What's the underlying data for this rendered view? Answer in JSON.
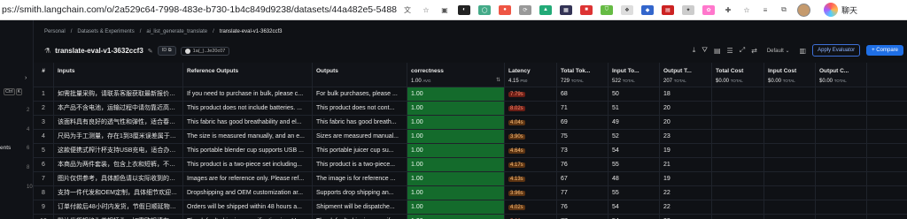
{
  "browser": {
    "url": "ps://smith.langchain.com/o/2a529c64-7998-483e-b730-1b4c849d9238/datasets/44a482e5-5488-45a2-8a37-f...",
    "chat_label": "聊天"
  },
  "rail": {
    "shortcut": [
      "Ctrl",
      "K"
    ],
    "nums": [
      "2",
      "4",
      "6",
      "8",
      "10"
    ],
    "ents_label": "ents"
  },
  "breadcrumb": [
    "Personal",
    "Datasets & Experiments",
    "ai_list_generate_translate",
    "translate-eval-v1-3632ccf3"
  ],
  "header": {
    "title": "translate-eval-v1-3632ccf3",
    "id_pill": "ID",
    "commit_pill": "1a(_)..Je20c07"
  },
  "toolbar": {
    "default_select": "Default",
    "apply_evaluator": "Apply Evaluator",
    "compare": "+ Compare"
  },
  "columns": {
    "idx": "#",
    "inputs": "Inputs",
    "reference": "Reference Outputs",
    "outputs": "Outputs",
    "correctness": "correctness",
    "correctness_sub": "1.00",
    "correctness_sub_suffix": "AVG",
    "latency": "Latency",
    "latency_sub": "4.15",
    "latency_sub_suffix": "P50",
    "total_tokens": "Total Tok...",
    "total_tokens_sub": "729",
    "total_tokens_sub_suffix": "TOTAL",
    "input_tokens": "Input To...",
    "input_tokens_sub": "522",
    "input_tokens_sub_suffix": "TOTAL",
    "output_tokens": "Output T...",
    "output_tokens_sub": "207",
    "output_tokens_sub_suffix": "TOTAL",
    "total_cost": "Total Cost",
    "total_cost_sub": "$0.00",
    "total_cost_sub_suffix": "TOTAL",
    "input_cost": "Input Cost",
    "input_cost_sub": "$0.00",
    "input_cost_sub_suffix": "TOTAL",
    "output_cost": "Output C...",
    "output_cost_sub": "$0.00",
    "output_cost_sub_suffix": "TOTAL"
  },
  "rows": [
    {
      "n": "1",
      "inputs": "如需批量采购，请联系客服获取最新报价和...",
      "ref": "If you need to purchase in bulk, please c...",
      "out": "For bulk purchases, please ...",
      "corr": "1.00",
      "lat": "7.79s",
      "lat_level": "hi",
      "tt": "68",
      "it": "50",
      "ot": "18"
    },
    {
      "n": "2",
      "inputs": "本产品不含电池，运输过程中请勿靠近高温...",
      "ref": "This product does not include batteries. ...",
      "out": "This product does not cont...",
      "corr": "1.00",
      "lat": "8.02s",
      "lat_level": "hi",
      "tt": "71",
      "it": "51",
      "ot": "20"
    },
    {
      "n": "3",
      "inputs": "该面料具有良好的透气性和弹性，适合春夏...",
      "ref": "This fabric has good breathability and el...",
      "out": "This fabric has good breath...",
      "corr": "1.00",
      "lat": "4.04s",
      "lat_level": "mid",
      "tt": "69",
      "it": "49",
      "ot": "20"
    },
    {
      "n": "4",
      "inputs": "尺码为手工测量，存在1到3厘米误差属于正...",
      "ref": "The size is measured manually, and an e...",
      "out": "Sizes are measured manual...",
      "corr": "1.00",
      "lat": "3.90s",
      "lat_level": "mid",
      "tt": "75",
      "it": "52",
      "ot": "23"
    },
    {
      "n": "5",
      "inputs": "这款便携式榨汁杯支持USB充电，适合办公...",
      "ref": "This portable blender cup supports USB ...",
      "out": "This portable juicer cup su...",
      "corr": "1.00",
      "lat": "4.64s",
      "lat_level": "mid",
      "tt": "73",
      "it": "54",
      "ot": "19"
    },
    {
      "n": "6",
      "inputs": "本商品为两件套装，包含上衣和短裤，不单...",
      "ref": "This product is a two-piece set including...",
      "out": "This product is a two-piece...",
      "corr": "1.00",
      "lat": "4.17s",
      "lat_level": "mid",
      "tt": "76",
      "it": "55",
      "ot": "21"
    },
    {
      "n": "7",
      "inputs": "图片仅供参考，具体颜色请以实际收到的商...",
      "ref": "Images are for reference only. Please ref...",
      "out": "The image is for reference ...",
      "corr": "1.00",
      "lat": "4.13s",
      "lat_level": "mid",
      "tt": "67",
      "it": "48",
      "ot": "19"
    },
    {
      "n": "8",
      "inputs": "支持一件代发和OEM定制，具体细节欢迎来...",
      "ref": "Dropshipping and OEM customization ar...",
      "out": "Supports drop shipping an...",
      "corr": "1.00",
      "lat": "3.96s",
      "lat_level": "mid",
      "tt": "77",
      "it": "55",
      "ot": "22"
    },
    {
      "n": "9",
      "inputs": "订单付款后48小时内发货，节假日顺延物流...",
      "ref": "Orders will be shipped within 48 hours a...",
      "out": "Shipment will be dispatche...",
      "corr": "1.00",
      "lat": "4.02s",
      "lat_level": "mid",
      "tt": "76",
      "it": "54",
      "ot": "22"
    },
    {
      "n": "10",
      "inputs": "默认发货规格为美规插头，如需欧规请在下...",
      "ref": "The default shipping specification is a U...",
      "out": "The default shipping specif...",
      "corr": "1.00",
      "lat": "5.06s",
      "lat_level": "hi",
      "tt": "77",
      "it": "54",
      "ot": "23"
    }
  ]
}
